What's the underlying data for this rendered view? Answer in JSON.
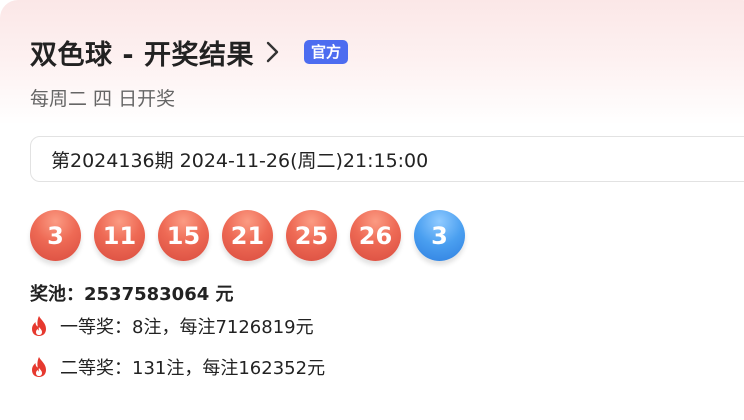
{
  "header": {
    "title": "双色球 - 开奖结果",
    "badge": "官方"
  },
  "schedule": "每周二 四 日开奖",
  "draw": {
    "label": "第2024136期 2024-11-26(周二)21:15:00"
  },
  "balls": {
    "red": [
      "3",
      "11",
      "15",
      "21",
      "25",
      "26"
    ],
    "blue": [
      "3"
    ]
  },
  "colors": {
    "red_ball": "#e85d4a",
    "blue_ball": "#3f91ea",
    "badge": "#4c6cf0",
    "fire": "#e6392f"
  },
  "pool": {
    "label": "奖池：",
    "amount": "2537583064 元"
  },
  "prizes": [
    {
      "level": "一等奖：",
      "detail": "8注，每注7126819元"
    },
    {
      "level": "二等奖：",
      "detail": "131注，每注162352元"
    }
  ],
  "icons": {
    "chevron": "chevron-right-icon",
    "fire": "fire-icon"
  }
}
